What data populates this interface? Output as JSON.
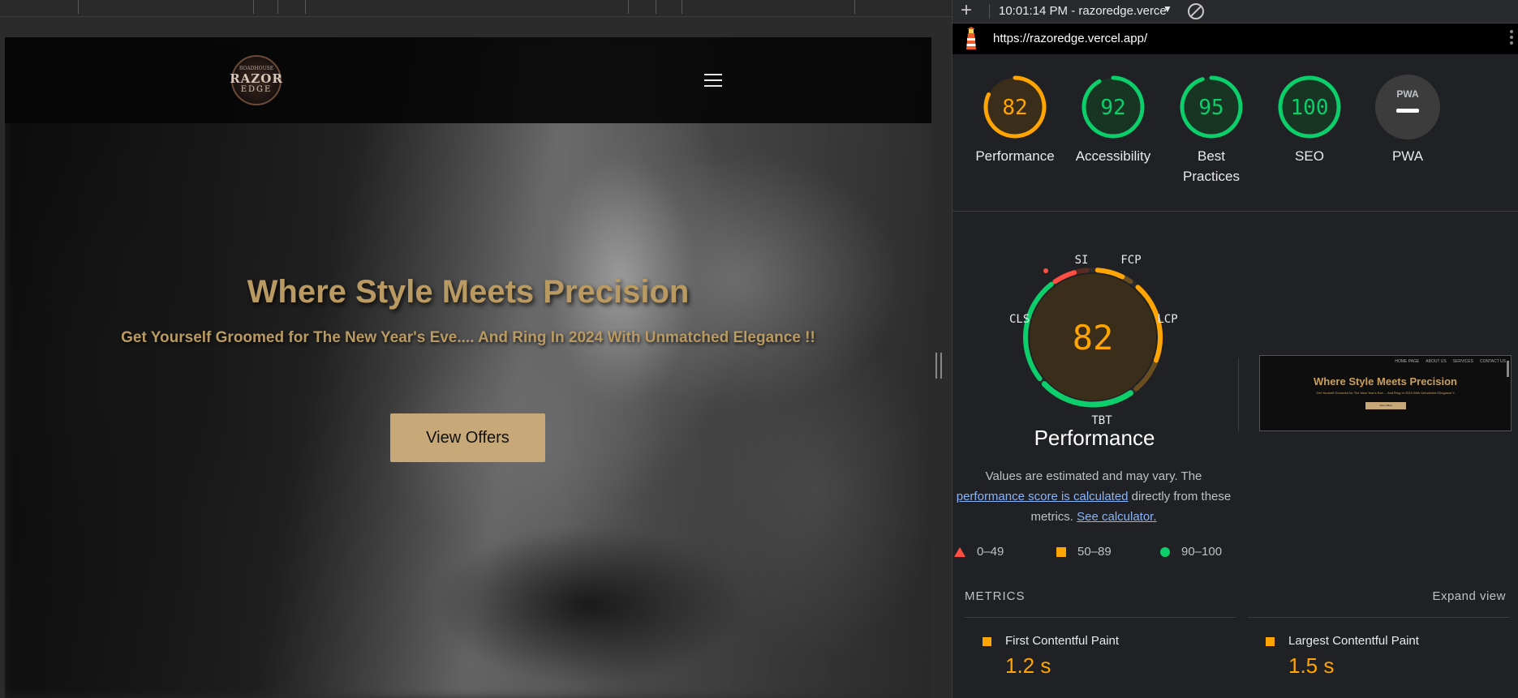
{
  "browser_preview": {
    "logo": {
      "line1": "ROADHOUSE",
      "line2": "RAZOR",
      "line3": "EDGE"
    },
    "hero": {
      "title": "Where Style Meets Precision",
      "subtitle": "Get Yourself Groomed for The New Year's Eve.... And Ring In 2024 With Unmatched Elegance !!",
      "button_label": "View Offers"
    }
  },
  "lighthouse": {
    "toolbar": {
      "add_icon": "plus-icon",
      "report_time": "10:01:14 PM - razoredge.verce",
      "dropdown_icon": "triangle-down-icon",
      "clear_icon": "block-icon"
    },
    "url": "https://razoredge.vercel.app/",
    "categories": [
      {
        "label": "Performance",
        "score": 82,
        "color": "#ffa400"
      },
      {
        "label": "Accessibility",
        "score": 92,
        "color": "#0cce6b"
      },
      {
        "label": "Best Practices",
        "score": 95,
        "color": "#0cce6b"
      },
      {
        "label": "SEO",
        "score": 100,
        "color": "#0cce6b"
      },
      {
        "label": "PWA",
        "score": null,
        "icon_text": "PWA",
        "color": "#9aa0a6"
      }
    ],
    "performance": {
      "score": 82,
      "title": "Performance",
      "gauge_labels": {
        "si": "SI",
        "fcp": "FCP",
        "lcp": "LCP",
        "tbt": "TBT",
        "cls": "CLS"
      },
      "description_before": "Values are estimated and may vary. The ",
      "description_link": "performance score is calculated",
      "description_middle": " directly from these metrics. ",
      "calculator_link": "See calculator.",
      "legend": [
        {
          "range": "0–49",
          "shape": "triangle",
          "color": "#ff4e42"
        },
        {
          "range": "50–89",
          "shape": "square",
          "color": "#ffa400"
        },
        {
          "range": "90–100",
          "shape": "circle",
          "color": "#0cce6b"
        }
      ]
    },
    "thumbnail": {
      "nav_items": [
        "HOME PAGE",
        "ABOUT US",
        "SERVICES",
        "CONTACT US"
      ],
      "title": "Where Style Meets Precision",
      "subtitle": "Get Yourself Groomed for The New Year's Eve.... And Ring In 2024 With Unmatched Elegance !!",
      "button_label": "View Offers"
    },
    "metrics": {
      "title": "METRICS",
      "expand_label": "Expand view",
      "items": [
        {
          "name": "First Contentful Paint",
          "value": "1.2 s",
          "status_color": "#ffa400"
        },
        {
          "name": "Largest Contentful Paint",
          "value": "1.5 s",
          "status_color": "#ffa400"
        }
      ]
    }
  }
}
